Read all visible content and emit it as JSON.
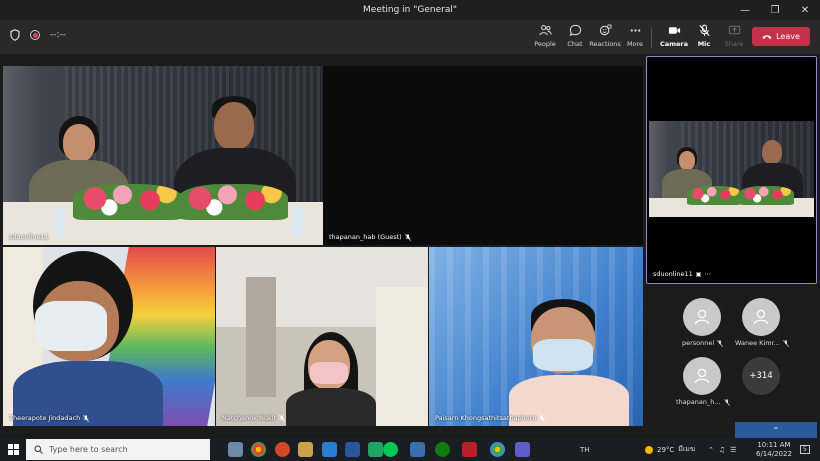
{
  "window": {
    "title": "Meeting in \"General\""
  },
  "toolbar": {
    "timer": "--:--",
    "people": "People",
    "chat": "Chat",
    "reactions": "Reactions",
    "more": "More",
    "camera": "Camera",
    "mic": "Mic",
    "share": "Share",
    "leave": "Leave"
  },
  "participants": {
    "main_top_left": "sduonline11",
    "main_top_right": "thapanan_hab (Guest)",
    "bottom_1": "Theerapote Jindadach",
    "bottom_2": "Natchanok Nukit",
    "bottom_3": "Paisarn Khongsathitsathaphorn",
    "pinned": "sduonline11",
    "side_1": "personnel",
    "side_2": "Wanee Kimr...",
    "side_3": "thapanan_h...",
    "overflow_count": "+314"
  },
  "taskbar": {
    "search_placeholder": "Type here to search",
    "lang": "TH",
    "weather_temp": "29°C",
    "weather_desc": "มีเมฆ",
    "time": "10:11 AM",
    "date": "6/14/2022",
    "notifications": "5"
  },
  "colors": {
    "leave": "#c4314b",
    "pinned_border": "#8b8cc7",
    "accent": "#6264a7"
  }
}
